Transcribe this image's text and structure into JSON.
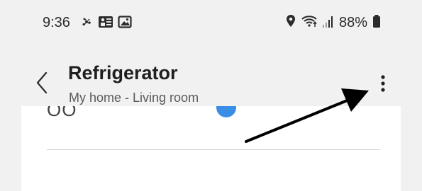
{
  "status_bar": {
    "time": "9:36",
    "left_icons": [
      "fan-icon",
      "media-grid-icon",
      "image-icon"
    ],
    "right_icons": [
      "location-pin-icon",
      "wifi-icon",
      "signal-bars-icon",
      "battery-icon"
    ],
    "battery_percent": "88%"
  },
  "app_bar": {
    "title": "Refrigerator",
    "subtitle": "My home - Living room",
    "back_icon": "chevron-left-icon",
    "more_icon": "more-vertical-icon"
  },
  "card": {
    "partial_text": "OO",
    "accent_color": "#3a8ee6"
  },
  "annotation": {
    "arrow_color": "#000000"
  }
}
